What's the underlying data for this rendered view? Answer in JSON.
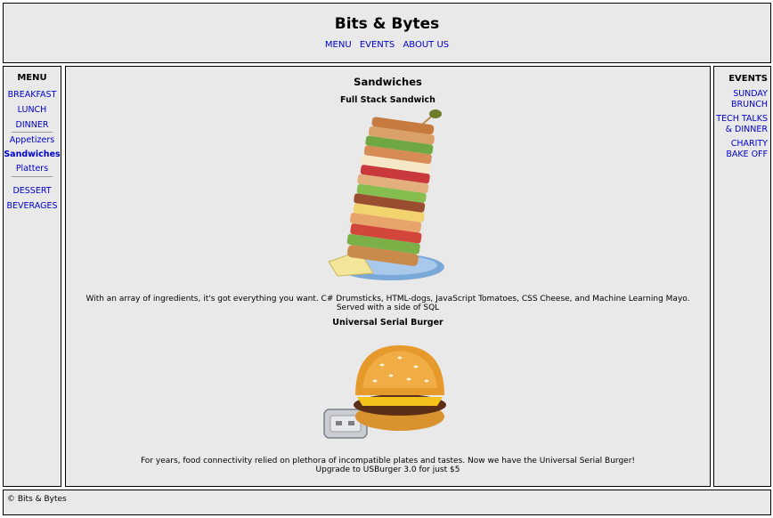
{
  "header": {
    "title": "Bits & Bytes",
    "nav": [
      "MENU",
      "EVENTS",
      "ABOUT US"
    ]
  },
  "left_menu": {
    "title": "MENU",
    "items": {
      "breakfast": "BREAKFAST",
      "lunch": "LUNCH",
      "dinner": "DINNER",
      "appetizers": "Appetizers",
      "sandwiches": "Sandwiches",
      "platters": "Platters",
      "dessert": "DESSERT",
      "beverages": "BEVERAGES"
    },
    "active": "Sandwiches"
  },
  "main": {
    "heading": "Sandwiches",
    "items": [
      {
        "name": "Full Stack Sandwich",
        "image_icon": "stacked-sandwich-image",
        "desc_line1": "With an array of ingredients, it's got everything you want. C# Drumsticks, HTML-dogs, JavaScript Tomatoes, CSS Cheese, and Machine Learning Mayo.",
        "desc_line2": "Served with a side of SQL"
      },
      {
        "name": "Universal Serial Burger",
        "image_icon": "usb-burger-image",
        "desc_line1": "For years, food connectivity relied on plethora of incompatible plates and tastes. Now we have the Universal Serial Burger!",
        "desc_line2": "Upgrade to USBurger 3.0 for just $5"
      }
    ]
  },
  "right_events": {
    "title": "EVENTS",
    "items": [
      "SUNDAY BRUNCH",
      "TECH TALKS & DINNER",
      "CHARITY BAKE OFF"
    ]
  },
  "footer": {
    "copyright": "© Bits & Bytes"
  },
  "colors": {
    "panel_bg": "#e9e9e9",
    "link": "#0000cc",
    "border": "#000000"
  }
}
